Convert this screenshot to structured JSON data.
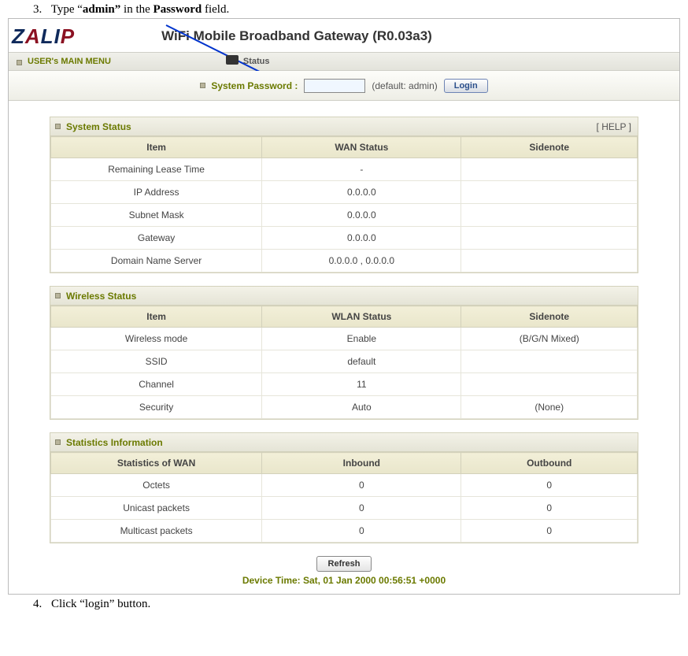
{
  "instructions": {
    "step3_num": "3.",
    "step3_pre": "Type “",
    "step3_bold": "admin”",
    "step3_mid": " in the ",
    "step3_bold2": "Password",
    "step3_post": " field.",
    "step4_num": "4.",
    "step4_text": "Click “login” button."
  },
  "header": {
    "title": "WiFi Mobile Broadband Gateway (R0.03a3)"
  },
  "menubar": {
    "main": "USER's MAIN MENU",
    "status": "Status"
  },
  "login": {
    "label": "System Password :",
    "value": "",
    "default_hint": "(default: admin)",
    "button": "Login"
  },
  "sections": {
    "system": {
      "title": "System Status",
      "help": "[ HELP ]",
      "cols": [
        "Item",
        "WAN Status",
        "Sidenote"
      ],
      "rows": [
        [
          "Remaining Lease Time",
          "-",
          ""
        ],
        [
          "IP Address",
          "0.0.0.0",
          ""
        ],
        [
          "Subnet Mask",
          "0.0.0.0",
          ""
        ],
        [
          "Gateway",
          "0.0.0.0",
          ""
        ],
        [
          "Domain Name Server",
          "0.0.0.0 , 0.0.0.0",
          ""
        ]
      ]
    },
    "wireless": {
      "title": "Wireless Status",
      "cols": [
        "Item",
        "WLAN Status",
        "Sidenote"
      ],
      "rows": [
        [
          "Wireless mode",
          "Enable",
          "(B/G/N Mixed)"
        ],
        [
          "SSID",
          "default",
          ""
        ],
        [
          "Channel",
          "11",
          ""
        ],
        [
          "Security",
          "Auto",
          "(None)"
        ]
      ]
    },
    "stats": {
      "title": "Statistics Information",
      "cols": [
        "Statistics of WAN",
        "Inbound",
        "Outbound"
      ],
      "rows": [
        [
          "Octets",
          "0",
          "0"
        ],
        [
          "Unicast packets",
          "0",
          "0"
        ],
        [
          "Multicast packets",
          "0",
          "0"
        ]
      ]
    }
  },
  "footer": {
    "refresh": "Refresh",
    "device_time": "Device Time: Sat, 01 Jan 2000 00:56:51 +0000"
  }
}
